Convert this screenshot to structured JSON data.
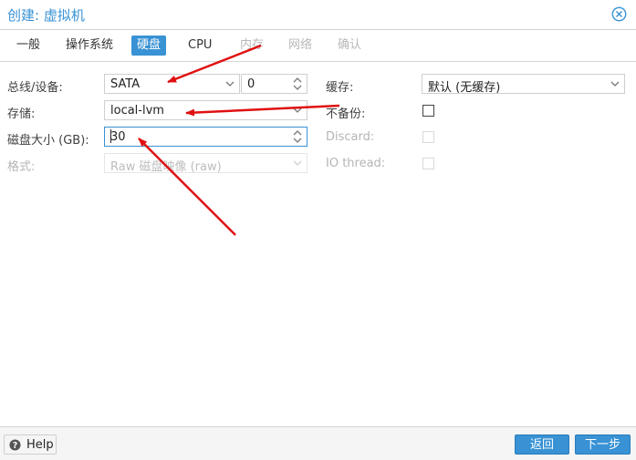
{
  "window": {
    "title": "创建: 虚拟机",
    "accent": "#3892d4"
  },
  "tabs": [
    {
      "label": "一般",
      "state": "normal"
    },
    {
      "label": "操作系统",
      "state": "normal"
    },
    {
      "label": "硬盘",
      "state": "active"
    },
    {
      "label": "CPU",
      "state": "normal"
    },
    {
      "label": "内存",
      "state": "disabled"
    },
    {
      "label": "网络",
      "state": "disabled"
    },
    {
      "label": "确认",
      "state": "disabled"
    }
  ],
  "form": {
    "bus_label": "总线/设备:",
    "bus_value": "SATA",
    "device_value": "0",
    "storage_label": "存储:",
    "storage_value": "local-lvm",
    "size_label": "磁盘大小 (GB):",
    "size_value": "30",
    "format_label": "格式:",
    "format_value": "Raw 磁盘映像 (raw)",
    "cache_label": "缓存:",
    "cache_value": "默认 (无缓存)",
    "nobackup_label": "不备份:",
    "discard_label": "Discard:",
    "iothread_label": "IO thread:"
  },
  "footer": {
    "help_label": "Help",
    "back_label": "返回",
    "next_label": "下一步"
  },
  "annotation_color": "#e01010"
}
